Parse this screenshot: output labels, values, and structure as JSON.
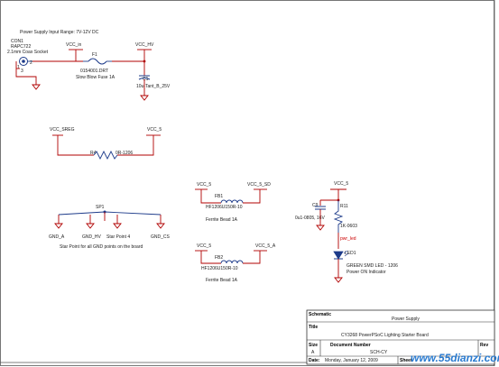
{
  "header": {
    "title": "Power Supply Input Range: 7V-12V DC"
  },
  "connector": {
    "ref": "CON1",
    "part": "RAPC722",
    "desc": "2.1mm Coax Socket"
  },
  "nets": {
    "vcc_in": "VCC_in",
    "vcc_hv": "VCC_HV",
    "vcc_sreg": "VCC_SREG",
    "vcc_5": "VCC_5",
    "vcc_5_sd": "VCC_5_SD",
    "vcc_5_a": "VCC_5_A",
    "gnd_a": "GND_A",
    "gnd_hv": "GND_HV",
    "gnd_cs": "GND_CS",
    "star4": "Star Point 4",
    "pwr_led": "pwr_led"
  },
  "fuse": {
    "ref": "F1",
    "part": "0154001.DRT",
    "desc": "Slow Blow Fuse 1A"
  },
  "c1": {
    "ref": "C1",
    "value": "10u-Tant_B_25V"
  },
  "r4": {
    "ref": "R4",
    "value": "0R-1206"
  },
  "fb1": {
    "ref": "FB1",
    "part": "HF1206U150R-10",
    "desc": "Ferrite Bead 1A"
  },
  "fb2": {
    "ref": "FB2",
    "part": "HF1206U150R-10",
    "desc": "Ferrite Bead 1A"
  },
  "sp1": {
    "ref": "SP1",
    "note": "Star Point for all GND points on the board"
  },
  "c9": {
    "ref": "C9",
    "value": "0u1-0805, 16V"
  },
  "r11": {
    "ref": "R11",
    "value": "1K-0603"
  },
  "led1": {
    "ref": "LED1",
    "part": "GREEN SMD LED - 1206",
    "desc": "Power ON Indicator"
  },
  "titleblock": {
    "schematic_label": "Schematic",
    "schematic_value": "Power Supply",
    "title_label": "Title",
    "title_value": "CY3268 PowerPSoC Lighting Starter Board",
    "size_label": "Size",
    "size_value": "A",
    "doc_label": "Document Number",
    "doc_value": "SCH-CY",
    "rev_label": "Rev",
    "date_label": "Date:",
    "date_value": "Monday, January 12, 2009",
    "sheet_label": "Sheet"
  },
  "watermark": "www.55dianzi.com",
  "colors": {
    "wire": "#b00000",
    "annotation": "#cc0000",
    "component": "#1d3b8a"
  }
}
